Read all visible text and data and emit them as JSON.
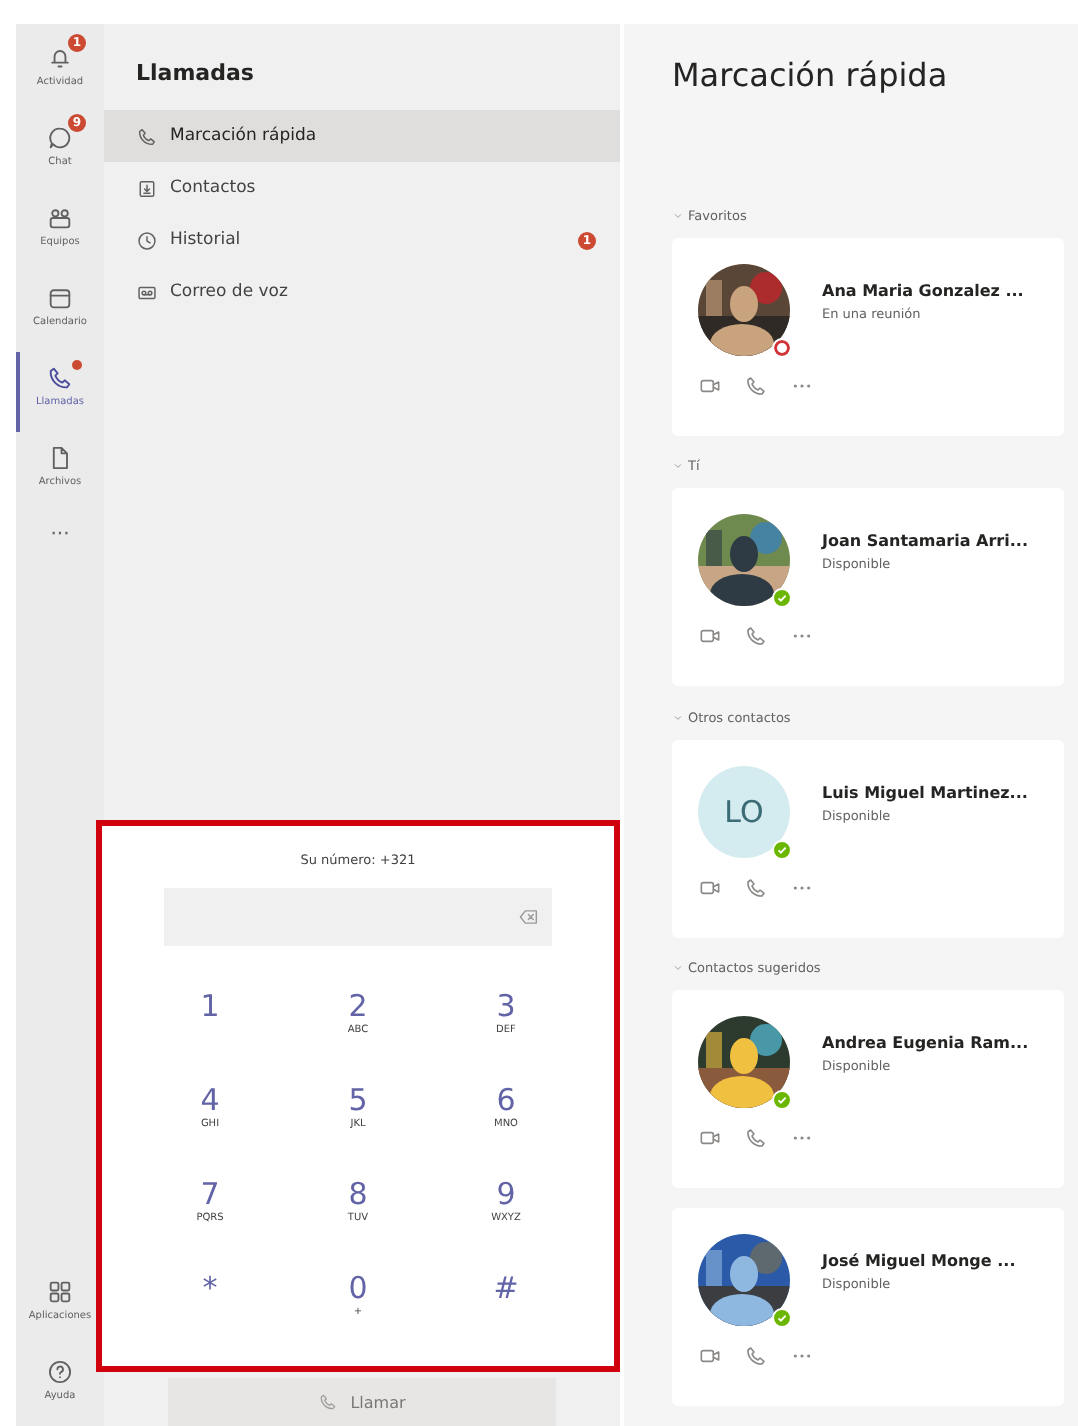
{
  "rail": {
    "items": [
      {
        "label": "Actividad",
        "badge": "1",
        "dot": false,
        "selected": false
      },
      {
        "label": "Chat",
        "badge": "9",
        "dot": false,
        "selected": false
      },
      {
        "label": "Equipos",
        "dot": false,
        "selected": false
      },
      {
        "label": "Calendario",
        "dot": false,
        "selected": false
      },
      {
        "label": "Llamadas",
        "dot": true,
        "selected": true
      },
      {
        "label": "Archivos",
        "dot": false,
        "selected": false
      }
    ],
    "more": "···",
    "bottom": [
      {
        "label": "Aplicaciones"
      },
      {
        "label": "Ayuda"
      }
    ]
  },
  "calls_panel": {
    "title": "Llamadas",
    "nav": [
      {
        "label": "Marcación rápida",
        "selected": true
      },
      {
        "label": "Contactos",
        "selected": false
      },
      {
        "label": "Historial",
        "badge": "1",
        "selected": false
      },
      {
        "label": "Correo de voz",
        "selected": false
      }
    ]
  },
  "dialpad": {
    "number_label": "Su número: +321",
    "keys": [
      {
        "digit": "1"
      },
      {
        "digit": "2",
        "letters": "ABC"
      },
      {
        "digit": "3",
        "letters": "DEF"
      },
      {
        "digit": "4",
        "letters": "GHI"
      },
      {
        "digit": "5",
        "letters": "JKL"
      },
      {
        "digit": "6",
        "letters": "MNO"
      },
      {
        "digit": "7",
        "letters": "PQRS"
      },
      {
        "digit": "8",
        "letters": "TUV"
      },
      {
        "digit": "9",
        "letters": "WXYZ"
      },
      {
        "digit": "*"
      },
      {
        "digit": "0",
        "letters": "+"
      },
      {
        "digit": "#"
      }
    ],
    "call_button": {
      "label": "Llamar",
      "disabled": true
    }
  },
  "speed_dial": {
    "title": "Marcación rápida",
    "groups": [
      {
        "title": "Favoritos",
        "contacts": [
          {
            "name": "Ana Maria Gonzalez ...",
            "status": "En una reunión",
            "available": false
          }
        ]
      },
      {
        "title": "Tí",
        "contacts": [
          {
            "name": "Joan Santamaria Arri...",
            "status": "Disponible",
            "available": true
          }
        ]
      },
      {
        "title": "Otros contactos",
        "contacts": [
          {
            "name": "Luis Miguel Martinez...",
            "status": "Disponible",
            "available": true,
            "avatar": {
              "kind": "initials",
              "initials": "LO"
            }
          }
        ]
      },
      {
        "title": "Contactos sugeridos",
        "contacts": [
          {
            "name": "Andrea Eugenia Ram...",
            "status": "Disponible",
            "available": true
          },
          {
            "name": "José Miguel Monge ...",
            "status": "Disponible",
            "available": true
          }
        ]
      }
    ]
  }
}
